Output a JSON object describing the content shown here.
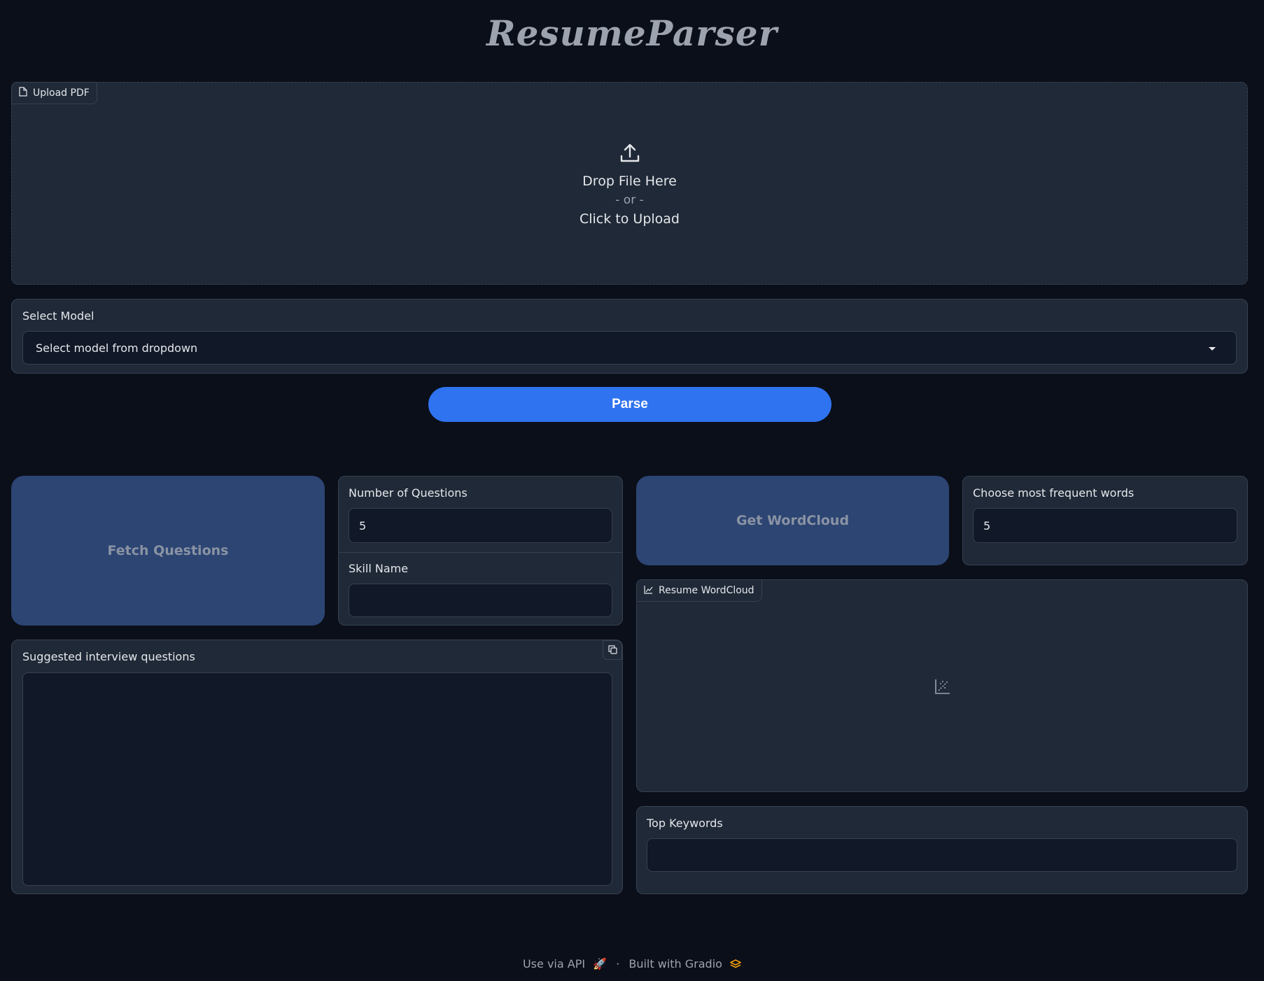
{
  "app": {
    "title": "ResumeParser"
  },
  "upload": {
    "chip_label": "Upload PDF",
    "drop_text": "Drop File Here",
    "or_text": "- or -",
    "click_text": "Click to Upload"
  },
  "model": {
    "label": "Select Model",
    "selected": "Select model from dropdown"
  },
  "parse_button": "Parse",
  "questions": {
    "fetch_button": "Fetch Questions",
    "num_label": "Number of Questions",
    "num_value": "5",
    "skill_label": "Skill Name",
    "skill_value": "",
    "output_label": "Suggested interview questions",
    "output_value": ""
  },
  "wordcloud": {
    "button": "Get WordCloud",
    "freq_label": "Choose most frequent words",
    "freq_value": "5",
    "plot_label": "Resume WordCloud",
    "keywords_label": "Top Keywords",
    "keywords_value": ""
  },
  "footer": {
    "api": "Use via API",
    "sep": "·",
    "built": "Built with Gradio"
  },
  "colors": {
    "background": "#0b0f19",
    "panel": "#1f2937",
    "primary": "#2f73f0",
    "secondary_button": "#2c4573"
  }
}
